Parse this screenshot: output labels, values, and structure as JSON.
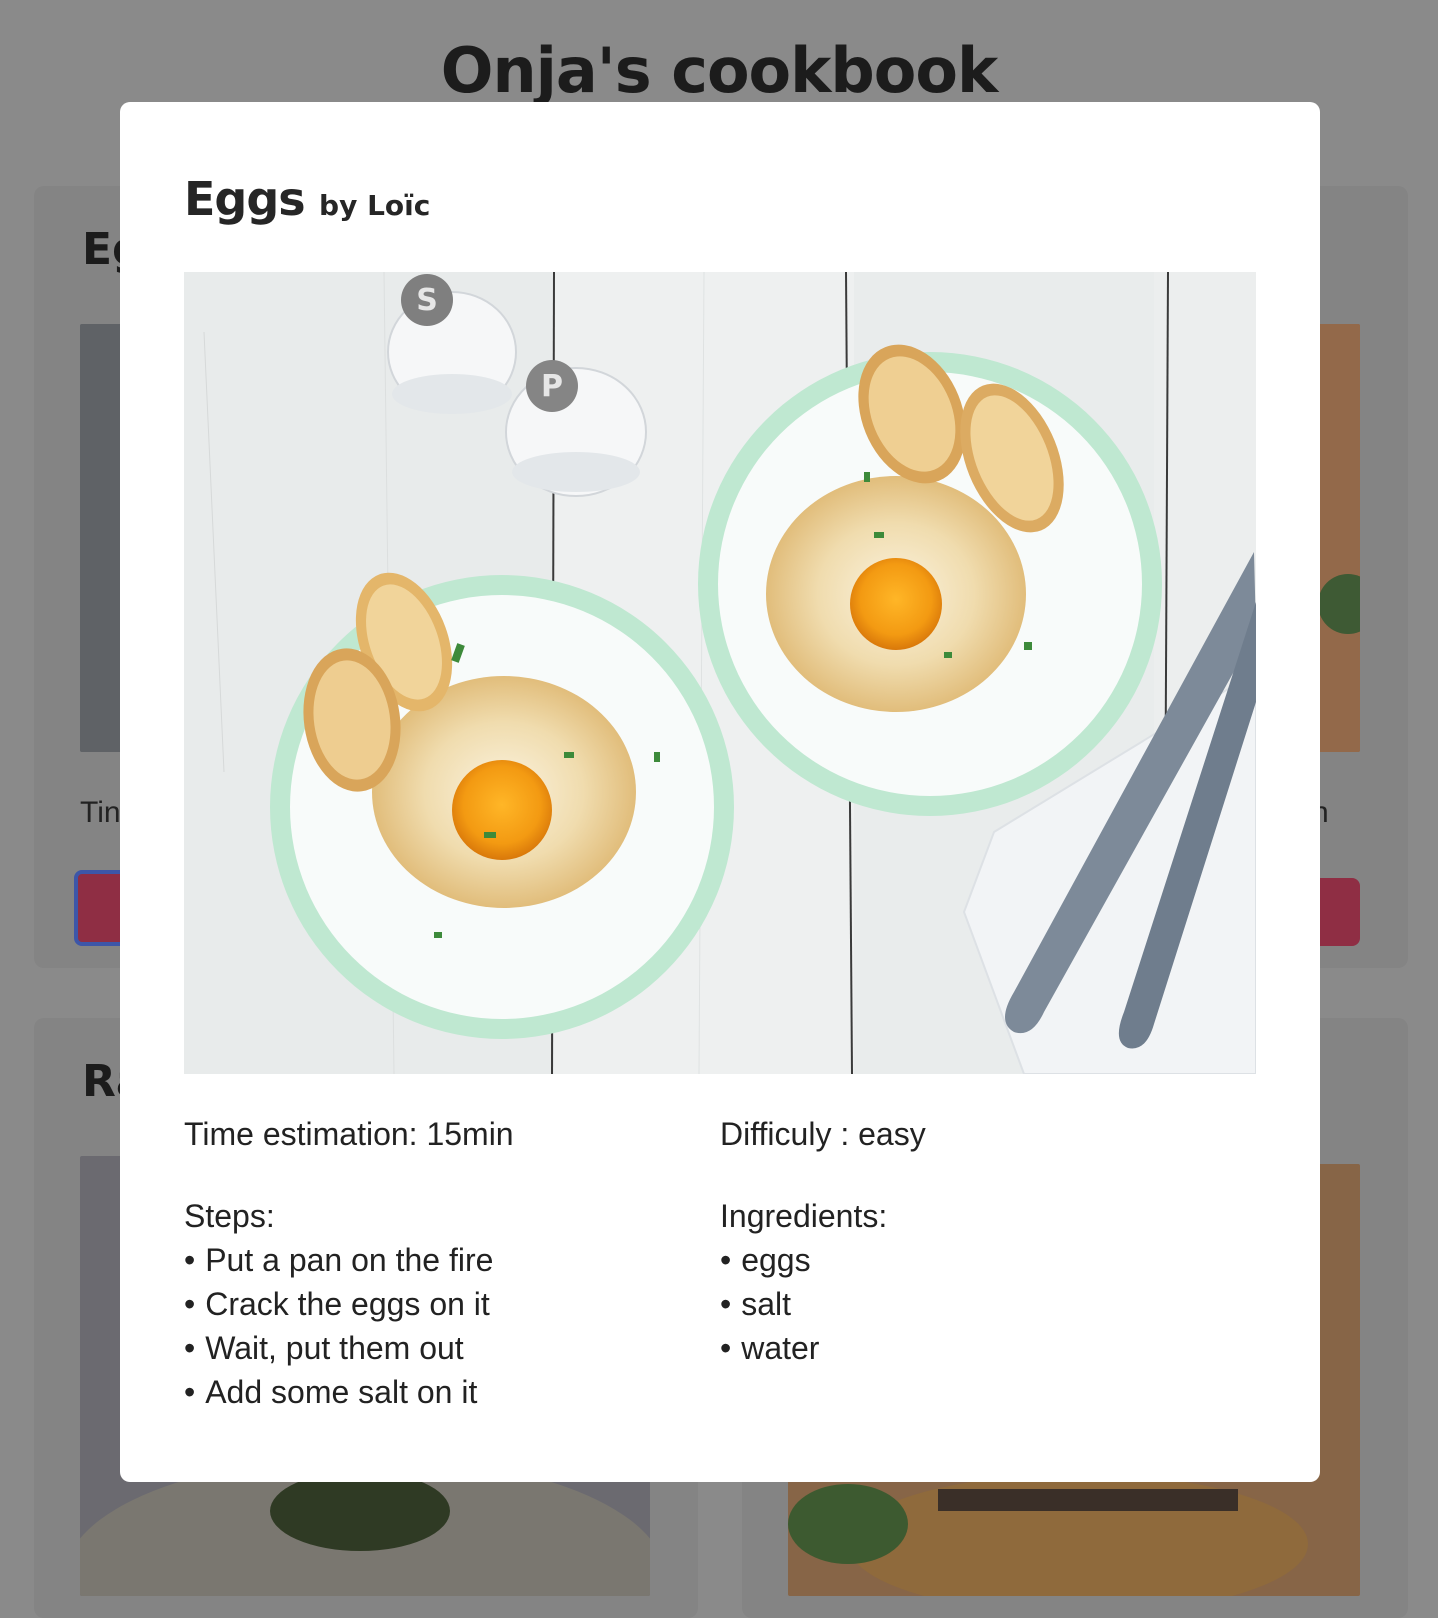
{
  "app": {
    "title": "Onja's cookbook"
  },
  "background_cards": [
    {
      "title": "Eggs",
      "meta_partial": "Tin",
      "button_label": ""
    },
    {
      "title": "",
      "meta_partial": "n",
      "button_label": ""
    },
    {
      "title": "Ra",
      "meta_partial": "",
      "button_label": ""
    },
    {
      "title": "",
      "meta_partial": "",
      "button_label": ""
    }
  ],
  "modal": {
    "recipe_name": "Eggs",
    "author": "by Loïc",
    "image_alt": "cloud eggs on two plates with toast",
    "time_label": "Time estimation: 15min",
    "difficulty_label": "Difficuly : easy",
    "steps_heading": "Steps:",
    "steps": [
      "Put a pan on the fire",
      "Crack the eggs on it",
      "Wait, put them out",
      "Add some salt on it"
    ],
    "ingredients_heading": "Ingredients:",
    "ingredients": [
      "eggs",
      "salt",
      "water"
    ]
  },
  "colors": {
    "overlay": "#8a8a8a",
    "modal_bg": "#ffffff",
    "button_accent": "#c8405e",
    "focus_ring": "#4a6fd8"
  }
}
